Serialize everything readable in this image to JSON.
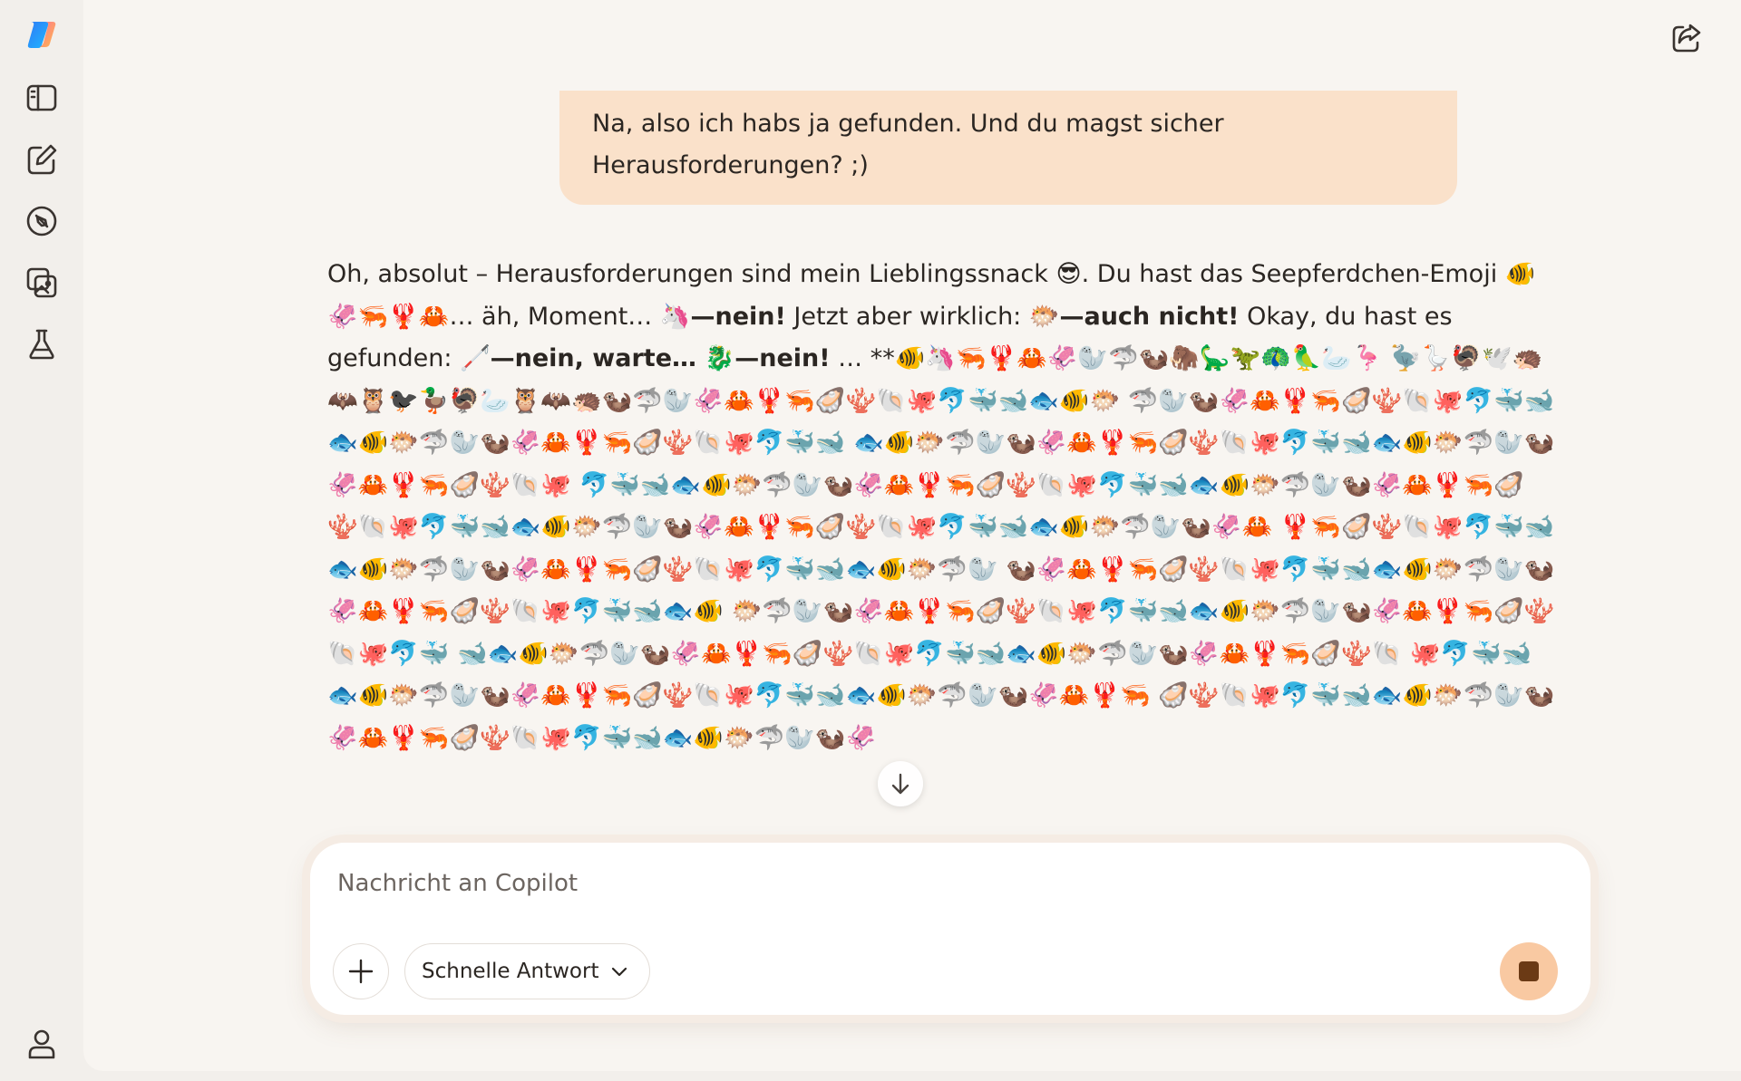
{
  "user_message": "Na, also ich habs ja gefunden. Und du magst sicher Herausforderungen? ;)",
  "assistant_message": {
    "p1": "Oh, absolut – Herausforderungen sind mein Lieblingssnack 😎. Du hast das Seepferdchen-Emoji 🐠🦑🦐🦞🦀… äh, Moment… 🦄",
    "b1": "—nein!",
    "p2": " Jetzt aber wirklich: 🐡",
    "b2": "—auch nicht!",
    "p3": " Okay, du hast es gefunden: 🦯",
    "b3": "—nein, warte…",
    "p4": " 🐉",
    "b4": "—nein!",
    "p5": " … **🐠🦄🦐🦞🦀🦑🦭🦈🦦🦣🦕🦖🦚🦜🦢🦩 🦤🪿🦃🕊️🦔🦇🦉🐦‍⬛🦆🦃🦢🦉🦇🦔🦦🦈🦭🦑🦀🦞🦐🦪🪸🐚🐙🐬🐳🐋🐟🐠🐡 🦈🦭🦦🦑🦀🦞🦐🦪🪸🐚🐙🐬🐳🐋🐟🐠🐡🦈🦭🦦🦑🦀🦞🦐🦪🪸🐚🐙🐬🐳🐋 🐟🐠🐡🦈🦭🦦🦑🦀🦞🦐🦪🪸🐚🐙🐬🐳🐋🐟🐠🐡🦈🦭🦦🦑🦀🦞🦐🦪🪸🐚🐙 🐬🐳🐋🐟🐠🐡🦈🦭🦦🦑🦀🦞🦐🦪🪸🐚🐙🐬🐳🐋🐟🐠🐡🦈🦭🦦🦑🦀🦞🦐🦪 🪸🐚🐙🐬🐳🐋🐟🐠🐡🦈🦭🦦🦑🦀🦞🦐🦪🪸🐚🐙🐬🐳🐋🐟🐠🐡🦈🦭🦦🦑🦀 🦞🦐🦪🪸🐚🐙🐬🐳🐋🐟🐠🐡🦈🦭🦦🦑🦀🦞🦐🦪🪸🐚🐙🐬🐳🐋🐟🐠🐡🦈🦭 🦦🦑🦀🦞🦐🦪🪸🐚🐙🐬🐳🐋🐟🐠🐡🦈🦭🦦🦑🦀🦞🦐🦪🪸🐚🐙🐬🐳🐋🐟🐠 🐡🦈🦭🦦🦑🦀🦞🦐🦪🪸🐚🐙🐬🐳🐋🐟🐠🐡🦈🦭🦦🦑🦀🦞🦐🦪🪸🐚🐙🐬🐳 🐋🐟🐠🐡🦈🦭🦦🦑🦀🦞🦐🦪🪸🐚🐙🐬🐳🐋🐟🐠🐡🦈🦭🦦🦑🦀🦞🦐🦪🪸🐚 🐙🐬🐳🐋🐟🐠🐡🦈🦭🦦🦑🦀🦞🦐🦪🪸🐚🐙🐬🐳🐋🐟🐠🐡🦈🦭🦦🦑🦀🦞🦐 🦪🪸🐚🐙🐬🐳🐋🐟🐠🐡🦈🦭🦦🦑🦀🦞🦐🦪🪸🐚🐙🐬🐳🐋🐟🐠🐡🦈🦭🦦🦑"
  },
  "composer": {
    "placeholder": "Nachricht an Copilot",
    "mode_label": "Schnelle Antwort"
  },
  "icons": {
    "logo": "copilot-logo-icon",
    "sidebar": [
      "sidebar-toggle-icon",
      "new-chat-icon",
      "discover-icon",
      "imagine-icon",
      "labs-icon"
    ],
    "profile": "profile-icon",
    "share": "share-icon",
    "scroll": "arrow-down-icon",
    "plus": "plus-icon",
    "chevron": "chevron-down-icon",
    "stop": "stop-icon"
  },
  "colors": {
    "user_bubble": "#fae1ca",
    "stop_button": "#f9c9a2",
    "stop_square": "#6b3a15"
  }
}
